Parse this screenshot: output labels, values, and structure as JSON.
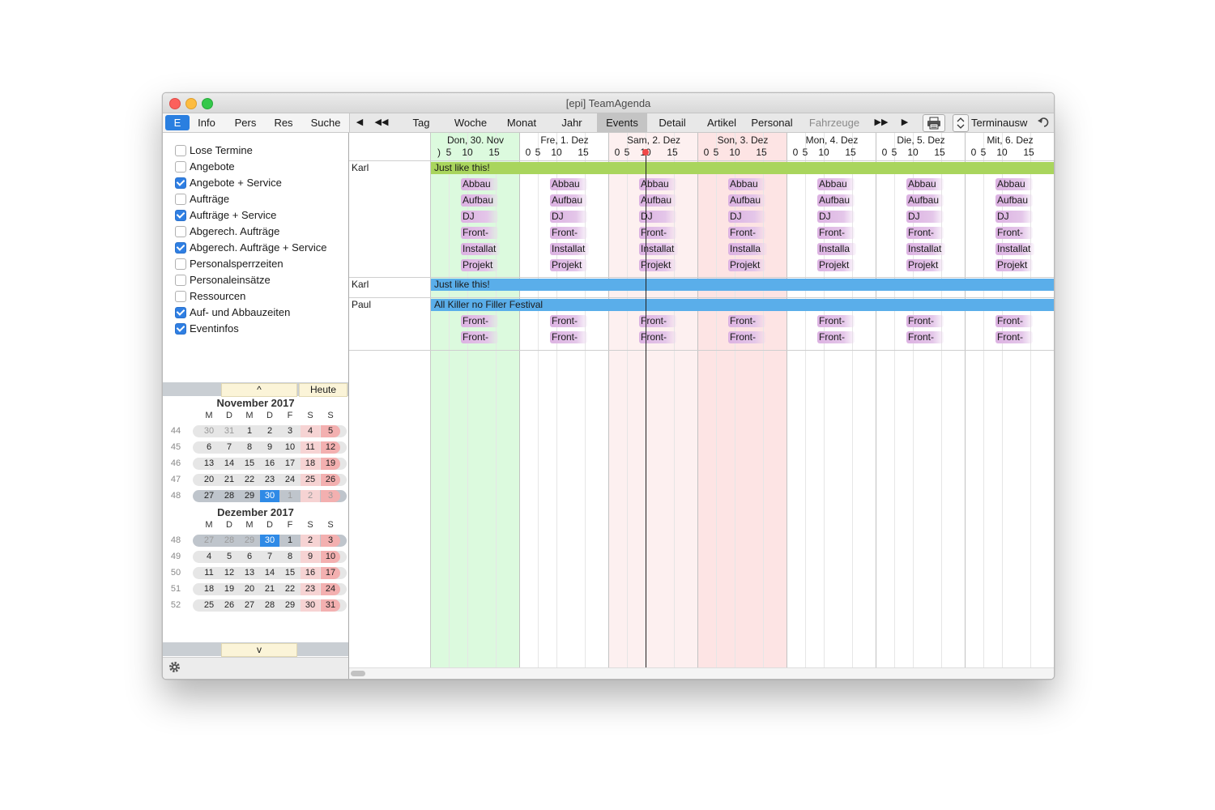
{
  "window": {
    "title": "[epi] TeamAgenda"
  },
  "toolbar": {
    "tabs_left": [
      "E",
      "Info",
      "Pers",
      "Res",
      "Suche"
    ],
    "nav": {
      "back": "◀",
      "fast_back": "◀◀",
      "fast_forward": "▶▶",
      "forward": "▶"
    },
    "views": [
      "Tag",
      "Woche",
      "Monat",
      "Jahr",
      "Events",
      "Detail",
      "Artikel",
      "Personal",
      "Fahrzeuge"
    ],
    "active_view": "Events",
    "terminauswahl": "Terminausw",
    "print_icon": "printer-icon",
    "restore_icon": "undo-arrow-icon"
  },
  "filters": [
    {
      "label": "Lose Termine",
      "checked": false
    },
    {
      "label": "Angebote",
      "checked": false
    },
    {
      "label": "Angebote + Service",
      "checked": true
    },
    {
      "label": "Aufträge",
      "checked": false
    },
    {
      "label": "Aufträge + Service",
      "checked": true
    },
    {
      "label": "Abgerech. Aufträge",
      "checked": false
    },
    {
      "label": "Abgerech. Aufträge + Service",
      "checked": true
    },
    {
      "label": "Personalsperrzeiten",
      "checked": false
    },
    {
      "label": "Personaleinsätze",
      "checked": false
    },
    {
      "label": "Ressourcen",
      "checked": false
    },
    {
      "label": "Auf- und Abbauzeiten",
      "checked": true
    },
    {
      "label": "Eventinfos",
      "checked": true
    }
  ],
  "calendar": {
    "up_label": "^",
    "down_label": "v",
    "today_label": "Heute",
    "weekday_headers": [
      "M",
      "D",
      "M",
      "D",
      "F",
      "S",
      "S"
    ],
    "months": [
      {
        "title": "November 2017",
        "weeks": [
          {
            "kw": "44",
            "days": [
              "30",
              "31",
              "1",
              "2",
              "3",
              "4",
              "5"
            ],
            "muted": [
              0,
              1
            ]
          },
          {
            "kw": "45",
            "days": [
              "6",
              "7",
              "8",
              "9",
              "10",
              "11",
              "12"
            ],
            "muted": []
          },
          {
            "kw": "46",
            "days": [
              "13",
              "14",
              "15",
              "16",
              "17",
              "18",
              "19"
            ],
            "muted": []
          },
          {
            "kw": "47",
            "days": [
              "20",
              "21",
              "22",
              "23",
              "24",
              "25",
              "26"
            ],
            "muted": []
          },
          {
            "kw": "48",
            "days": [
              "27",
              "28",
              "29",
              "30",
              "1",
              "2",
              "3"
            ],
            "muted": [
              4,
              5,
              6
            ],
            "current": true,
            "today_index": 3
          }
        ]
      },
      {
        "title": "Dezember 2017",
        "weeks": [
          {
            "kw": "48",
            "days": [
              "27",
              "28",
              "29",
              "30",
              "1",
              "2",
              "3"
            ],
            "muted": [
              0,
              1,
              2
            ],
            "current": true,
            "today_index": 3
          },
          {
            "kw": "49",
            "days": [
              "4",
              "5",
              "6",
              "7",
              "8",
              "9",
              "10"
            ],
            "muted": []
          },
          {
            "kw": "50",
            "days": [
              "11",
              "12",
              "13",
              "14",
              "15",
              "16",
              "17"
            ],
            "muted": []
          },
          {
            "kw": "51",
            "days": [
              "18",
              "19",
              "20",
              "21",
              "22",
              "23",
              "24"
            ],
            "muted": []
          },
          {
            "kw": "52",
            "days": [
              "25",
              "26",
              "27",
              "28",
              "29",
              "30",
              "31"
            ],
            "muted": []
          }
        ]
      }
    ]
  },
  "schedule": {
    "days": [
      "Don, 30. Nov",
      "Fre, 1. Dez",
      "Sam, 2. Dez",
      "Son, 3. Dez",
      "Mon, 4. Dez",
      "Die, 5. Dez",
      "Mit, 6. Dez"
    ],
    "hour_ticks": [
      "0",
      "5",
      "10",
      "15"
    ],
    "first_hour_tick": ")",
    "rows": [
      {
        "resource": "Karl",
        "event": "Just like this!",
        "event_color": "#a9d55d",
        "chips_per_day": [
          [
            "Abbau",
            "Aufbau",
            "DJ",
            "Front-",
            "Installat",
            "Projekt"
          ],
          [
            "Abbau",
            "Aufbau",
            "DJ",
            "Front-",
            "Installat",
            "Projekt"
          ],
          [
            "Abbau",
            "Aufbau",
            "DJ",
            "Front-",
            "Installat",
            "Projekt"
          ],
          [
            "Abbau",
            "Aufbau",
            "DJ",
            "Front-",
            "Installa",
            "Projekt"
          ],
          [
            "Abbau",
            "Aufbau",
            "DJ",
            "Front-",
            "Installa",
            "Projekt"
          ],
          [
            "Abbau",
            "Aufbau",
            "DJ",
            "Front-",
            "Installat",
            "Projekt"
          ],
          [
            "Abbau",
            "Aufbau",
            "DJ",
            "Front-",
            "Installat",
            "Projekt"
          ]
        ]
      },
      {
        "resource": "Karl",
        "event": "Just like this!",
        "event_color": "#5aaeea",
        "chips_per_day": []
      },
      {
        "resource": "Paul",
        "event": "All Killer no Filler Festival",
        "event_color": "#5aaeea",
        "chips_per_day": [
          [
            "Front-",
            "Front-"
          ],
          [
            "Front-",
            "Front-"
          ],
          [
            "Front-",
            "Front-"
          ],
          [
            "Front-",
            "Front-"
          ],
          [
            "Front-",
            "Front-"
          ],
          [
            "Front-",
            "Front-"
          ],
          [
            "Front-",
            "Front-"
          ]
        ]
      }
    ]
  },
  "settings_icon": "gear-icon"
}
